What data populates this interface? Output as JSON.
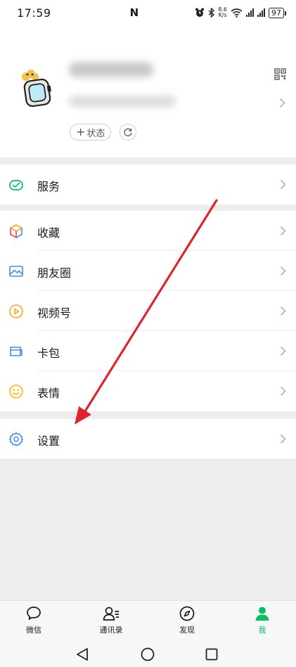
{
  "status_bar": {
    "time": "17:59",
    "nfc": "N",
    "speed_value": "8.6",
    "speed_unit": "K/s",
    "battery": "97"
  },
  "profile": {
    "status_button_label": "状态",
    "status_plus": "+"
  },
  "menu": {
    "services": "服务",
    "favorites": "收藏",
    "moments": "朋友圈",
    "channels": "视频号",
    "cards": "卡包",
    "stickers": "表情",
    "settings": "设置"
  },
  "tabbar": {
    "chats": "微信",
    "contacts": "通讯录",
    "discover": "发现",
    "me": "我"
  },
  "colors": {
    "brand_green": "#07c160",
    "arrow_red": "#e0242f"
  }
}
